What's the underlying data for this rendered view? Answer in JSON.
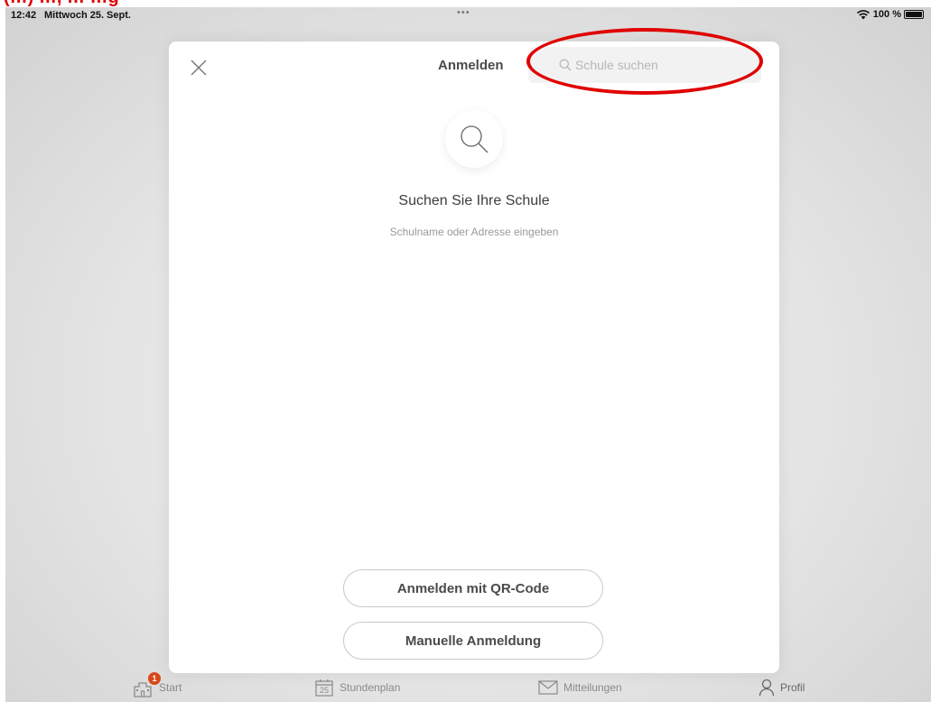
{
  "annotation": {
    "cropped_heading": "(…) …, … …g",
    "highlight_color": "#e00000"
  },
  "status_bar": {
    "time": "12:42",
    "date": "Mittwoch 25. Sept.",
    "multitask_dots": "•••",
    "battery_percent": "100 %",
    "icons": [
      "wifi-icon",
      "battery-icon"
    ]
  },
  "modal": {
    "title": "Anmelden",
    "close_icon": "close-icon",
    "search": {
      "placeholder": "Schule suchen",
      "value": "",
      "icon": "search-icon"
    },
    "hero": {
      "icon": "search-icon",
      "title": "Suchen Sie Ihre Schule",
      "subtitle": "Schulname oder Adresse eingeben"
    },
    "buttons": {
      "qr_login": "Anmelden mit QR-Code",
      "manual_login": "Manuelle Anmeldung"
    }
  },
  "tab_bar": {
    "items": [
      {
        "label": "Start",
        "icon": "school-icon",
        "badge": "1"
      },
      {
        "label": "Stundenplan",
        "icon": "calendar-icon",
        "day": "25"
      },
      {
        "label": "Mitteilungen",
        "icon": "mail-icon"
      },
      {
        "label": "Profil",
        "icon": "person-icon"
      }
    ],
    "badge_color": "#d9481b"
  }
}
